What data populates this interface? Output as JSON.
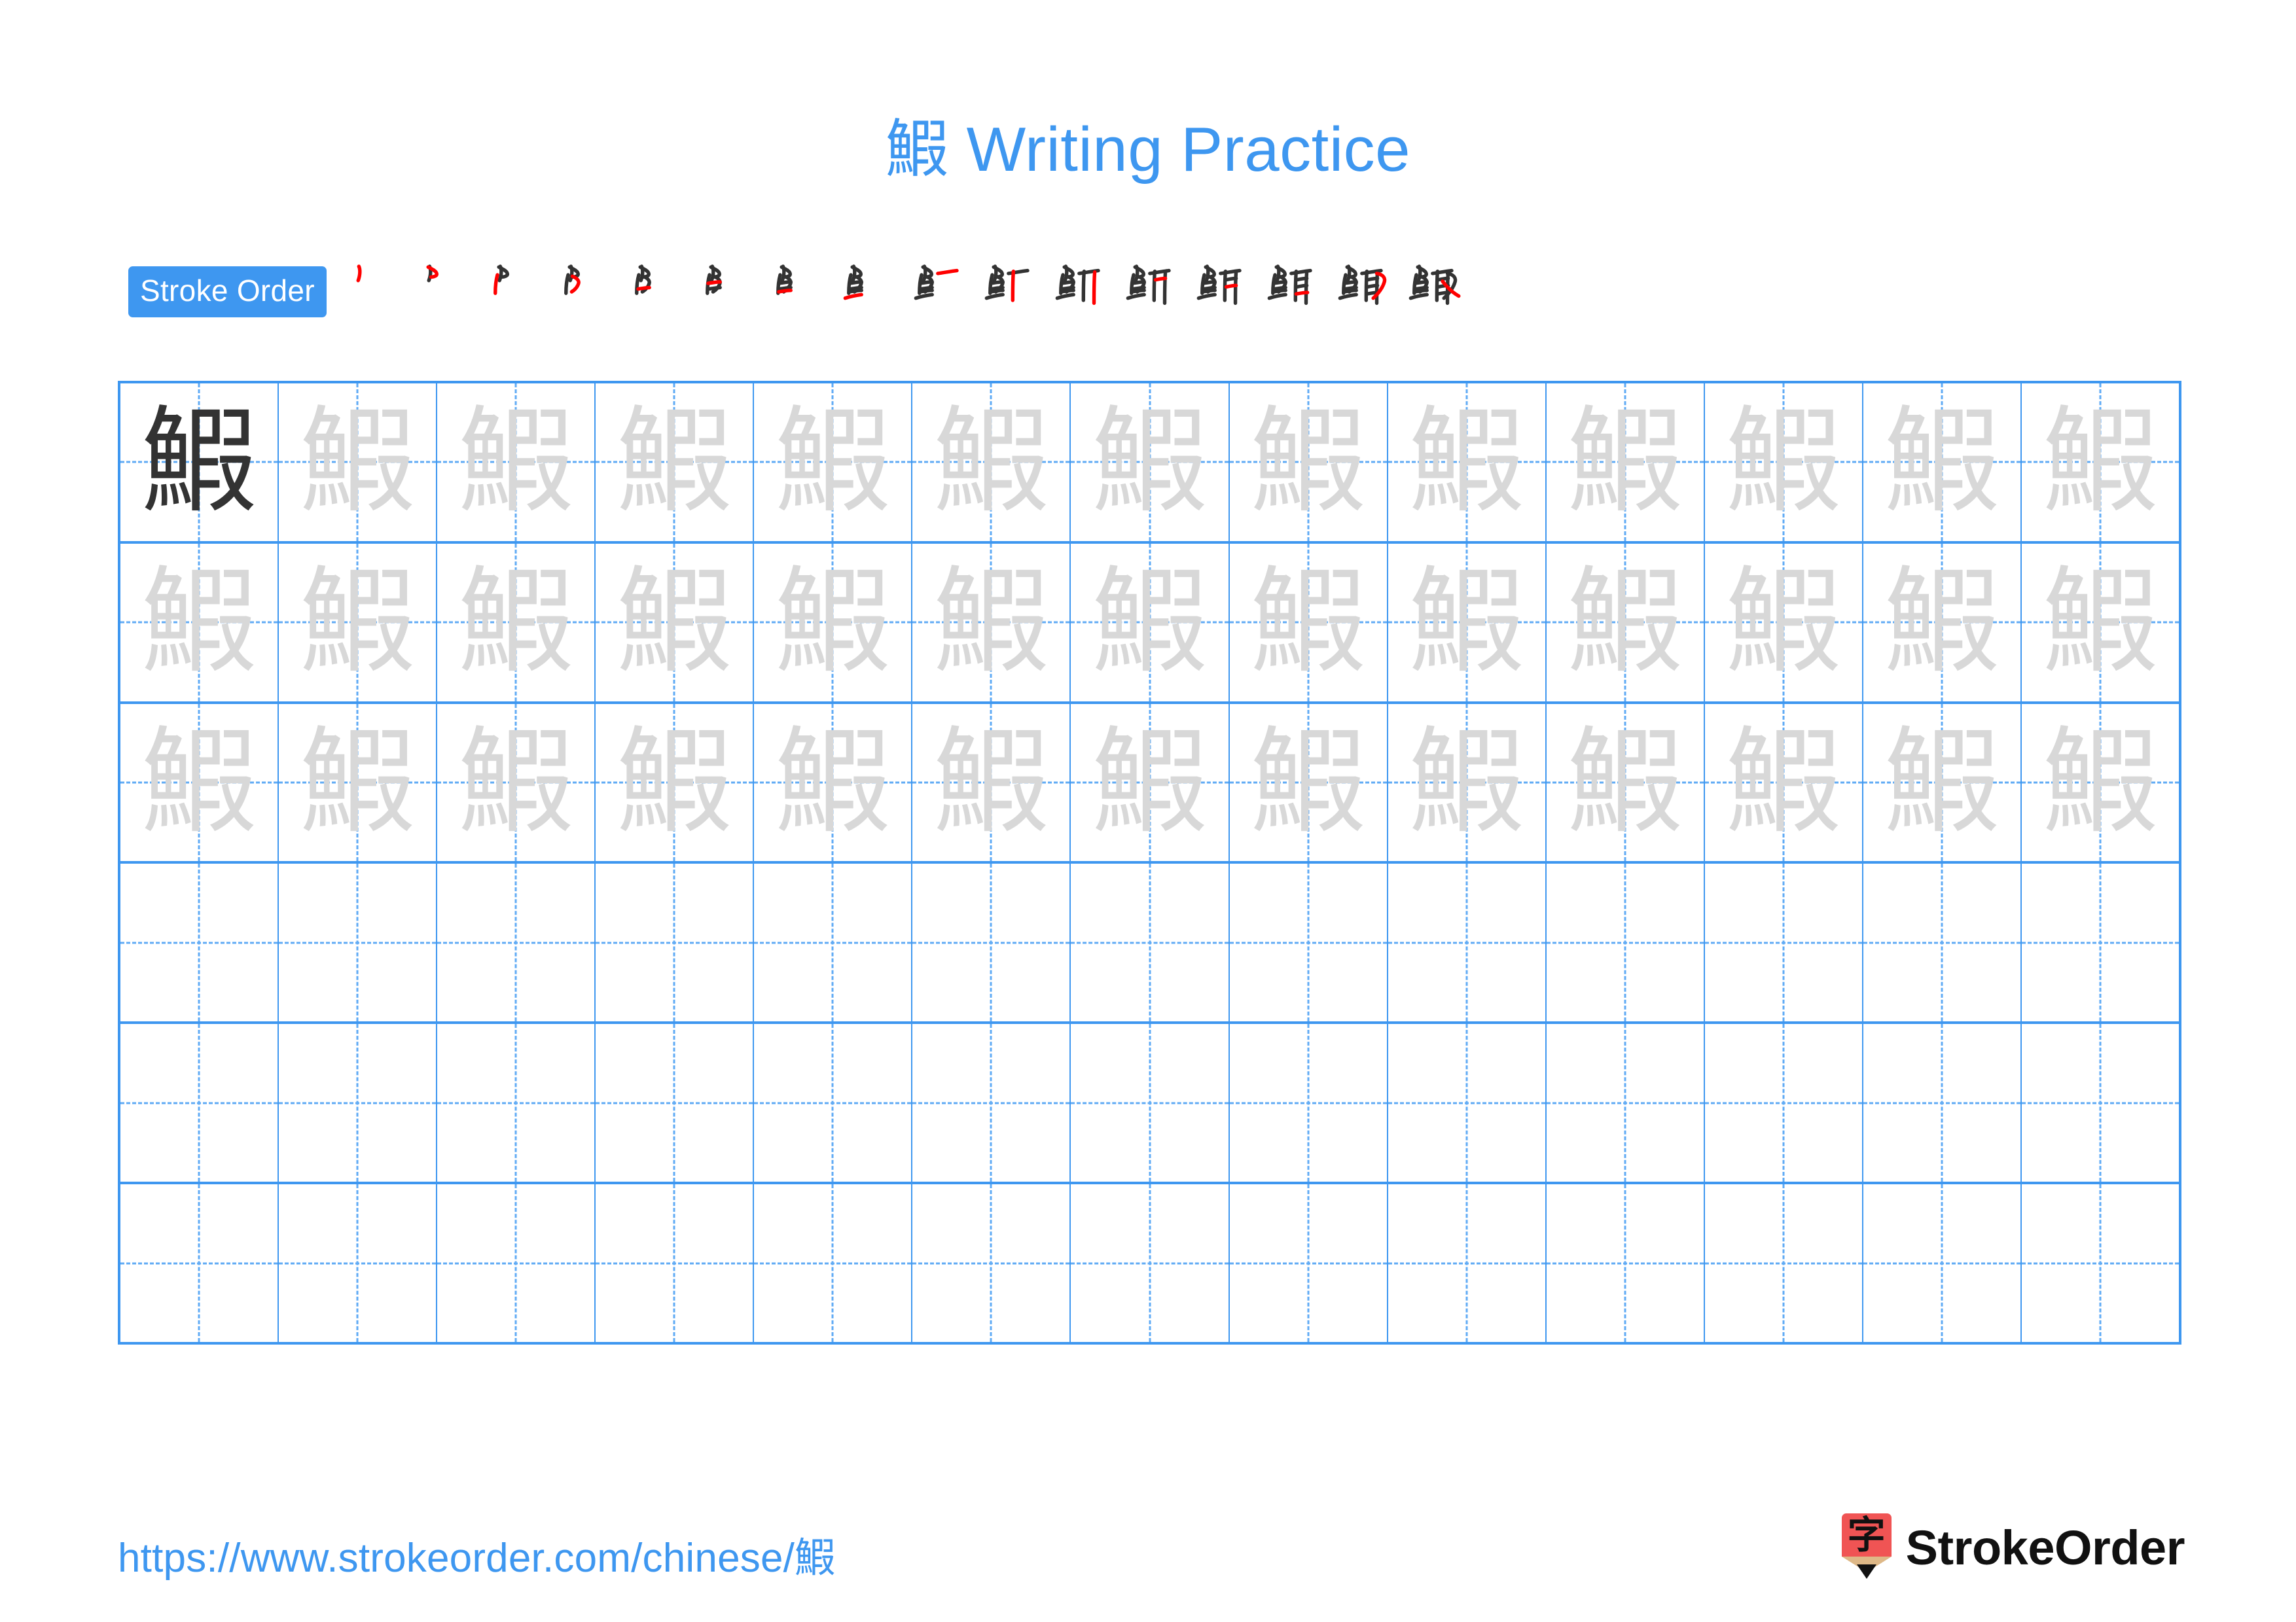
{
  "page": {
    "character": "鰕",
    "title_suffix": " Writing Practice",
    "accent_color": "#3E97F0",
    "trace_color": "#D8D8D8",
    "solid_color": "#333333"
  },
  "stroke_order": {
    "badge_label": "Stroke Order",
    "total_strokes": 16,
    "steps": [
      {
        "index": 1,
        "label": "stroke-1"
      },
      {
        "index": 2,
        "label": "stroke-2"
      },
      {
        "index": 3,
        "label": "stroke-3"
      },
      {
        "index": 4,
        "label": "stroke-4"
      },
      {
        "index": 5,
        "label": "stroke-5"
      },
      {
        "index": 6,
        "label": "stroke-6"
      },
      {
        "index": 7,
        "label": "stroke-7"
      },
      {
        "index": 8,
        "label": "stroke-8"
      },
      {
        "index": 9,
        "label": "stroke-9"
      },
      {
        "index": 10,
        "label": "stroke-10"
      },
      {
        "index": 11,
        "label": "stroke-11"
      },
      {
        "index": 12,
        "label": "stroke-12"
      },
      {
        "index": 13,
        "label": "stroke-13"
      },
      {
        "index": 14,
        "label": "stroke-14"
      },
      {
        "index": 15,
        "label": "stroke-15"
      },
      {
        "index": 16,
        "label": "stroke-16"
      }
    ]
  },
  "practice_grid": {
    "columns": 13,
    "rows": 6,
    "filled_rows": 3,
    "empty_rows": 3,
    "first_cell_style": "solid",
    "trace_character": "鰕"
  },
  "footer": {
    "url": "https://www.strokeorder.com/chinese/",
    "url_character": "鰕",
    "logo_glyph": "字",
    "logo_text": "StrokeOrder",
    "logo_body_color": "#F05454",
    "logo_wood_color": "#DEB887"
  }
}
